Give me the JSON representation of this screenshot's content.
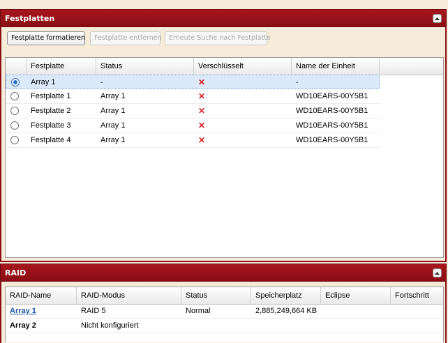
{
  "disks_panel": {
    "title": "Festplatten",
    "toolbar": {
      "format_label": "Festplatte formatieren",
      "remove_label": "Festplatte entfernen",
      "rescan_label": "Erneute Suche nach Festplatte"
    },
    "columns": [
      "Festplatte",
      "Status",
      "Verschlüsselt",
      "Name der Einheit"
    ],
    "rows": [
      {
        "name": "Array 1",
        "status": "-",
        "encrypted": "✕",
        "device": "-",
        "selected": true
      },
      {
        "name": "Festplatte 1",
        "status": "Array 1",
        "encrypted": "✕",
        "device": "WD10EARS-00Y5B1",
        "selected": false
      },
      {
        "name": "Festplatte 2",
        "status": "Array 1",
        "encrypted": "✕",
        "device": "WD10EARS-00Y5B1",
        "selected": false
      },
      {
        "name": "Festplatte 3",
        "status": "Array 1",
        "encrypted": "✕",
        "device": "WD10EARS-00Y5B1",
        "selected": false
      },
      {
        "name": "Festplatte 4",
        "status": "Array 1",
        "encrypted": "✕",
        "device": "WD10EARS-00Y5B1",
        "selected": false
      }
    ]
  },
  "raid_panel": {
    "title": "RAID",
    "columns": [
      "RAID-Name",
      "RAID-Modus",
      "Status",
      "Speicherplatz",
      "Eclipse",
      "Fortschritt"
    ],
    "rows": [
      {
        "name": "Array 1",
        "mode": "RAID 5",
        "status": "Normal",
        "capacity": "2,885,249,664 KB",
        "eclipse": "",
        "progress": ""
      },
      {
        "name": "Array 2",
        "mode": "Nicht konfiguriert",
        "status": "",
        "capacity": "",
        "eclipse": "",
        "progress": ""
      }
    ]
  },
  "colors": {
    "header_red": "#8b0d14",
    "background": "#f6ecd9",
    "selection": "#dbe9fa",
    "x_mark": "#d42020",
    "link": "#1c55a8"
  }
}
